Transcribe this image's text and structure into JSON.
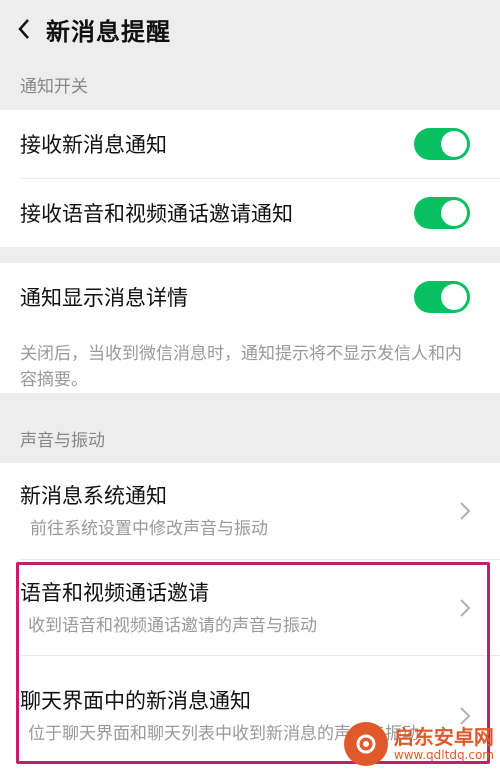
{
  "header": {
    "title": "新消息提醒"
  },
  "sections": {
    "notify_switch": "通知开关",
    "sound_vibration": "声音与振动"
  },
  "rows": {
    "receive_new": {
      "label": "接收新消息通知",
      "enabled": true
    },
    "receive_call": {
      "label": "接收语音和视频通话邀请通知",
      "enabled": true
    },
    "show_detail": {
      "label": "通知显示消息详情",
      "enabled": true,
      "desc": "关闭后，当收到微信消息时，通知提示将不显示发信人和内容摘要。"
    },
    "system_notify": {
      "label": "新消息系统通知",
      "desc": "前往系统设置中修改声音与振动"
    },
    "call_invite": {
      "label": "语音和视频通话邀请",
      "desc": "收到语音和视频通话邀请的声音与振动"
    },
    "chat_notify": {
      "label": "聊天界面中的新消息通知",
      "desc": "位于聊天界面和聊天列表中收到新消息的声音与振动"
    }
  },
  "watermark": {
    "name": "启东安卓网",
    "url": "www.qdltdq.com"
  },
  "colors": {
    "toggle_on": "#07c160",
    "highlight": "#c0206a",
    "watermark": "#e0592a"
  }
}
